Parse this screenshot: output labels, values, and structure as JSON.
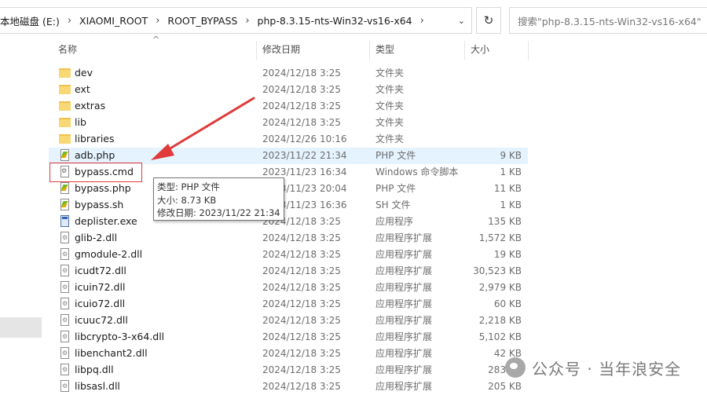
{
  "address": {
    "crumbs": [
      "本地磁盘 (E:)",
      "XIAOMI_ROOT",
      "ROOT_BYPASS",
      "php-8.3.15-nts-Win32-vs16-x64"
    ]
  },
  "search": {
    "placeholder": "搜索\"php-8.3.15-nts-Win32-vs16-x64\""
  },
  "columns": {
    "name": "名称",
    "date": "修改日期",
    "type": "类型",
    "size": "大小"
  },
  "files": [
    {
      "name": "dev",
      "date": "2024/12/18 3:25",
      "type": "文件夹",
      "size": "",
      "icon": "folder-icon"
    },
    {
      "name": "ext",
      "date": "2024/12/18 3:25",
      "type": "文件夹",
      "size": "",
      "icon": "folder-icon"
    },
    {
      "name": "extras",
      "date": "2024/12/18 3:25",
      "type": "文件夹",
      "size": "",
      "icon": "folder-icon"
    },
    {
      "name": "lib",
      "date": "2024/12/18 3:25",
      "type": "文件夹",
      "size": "",
      "icon": "folder-icon"
    },
    {
      "name": "libraries",
      "date": "2024/12/26 10:16",
      "type": "文件夹",
      "size": "",
      "icon": "folder-icon"
    },
    {
      "name": "adb.php",
      "date": "2023/11/22 21:34",
      "type": "PHP 文件",
      "size": "9 KB",
      "icon": "php-file-icon"
    },
    {
      "name": "bypass.cmd",
      "date": "2023/11/23 16:34",
      "type": "Windows 命令脚本",
      "size": "1 KB",
      "icon": "cmd-file-icon"
    },
    {
      "name": "bypass.php",
      "date": "2023/11/23 20:04",
      "type": "PHP 文件",
      "size": "11 KB",
      "icon": "php-file-icon"
    },
    {
      "name": "bypass.sh",
      "date": "2023/11/23 16:36",
      "type": "SH 文件",
      "size": "1 KB",
      "icon": "sh-file-icon"
    },
    {
      "name": "deplister.exe",
      "date": "2024/12/18 3:25",
      "type": "应用程序",
      "size": "135 KB",
      "icon": "exe-file-icon"
    },
    {
      "name": "glib-2.dll",
      "date": "2024/12/18 3:25",
      "type": "应用程序扩展",
      "size": "1,572 KB",
      "icon": "dll-file-icon"
    },
    {
      "name": "gmodule-2.dll",
      "date": "2024/12/18 3:25",
      "type": "应用程序扩展",
      "size": "19 KB",
      "icon": "dll-file-icon"
    },
    {
      "name": "icudt72.dll",
      "date": "2024/12/18 3:25",
      "type": "应用程序扩展",
      "size": "30,523 KB",
      "icon": "dll-file-icon"
    },
    {
      "name": "icuin72.dll",
      "date": "2024/12/18 3:25",
      "type": "应用程序扩展",
      "size": "2,979 KB",
      "icon": "dll-file-icon"
    },
    {
      "name": "icuio72.dll",
      "date": "2024/12/18 3:25",
      "type": "应用程序扩展",
      "size": "60 KB",
      "icon": "dll-file-icon"
    },
    {
      "name": "icuuc72.dll",
      "date": "2024/12/18 3:25",
      "type": "应用程序扩展",
      "size": "2,218 KB",
      "icon": "dll-file-icon"
    },
    {
      "name": "libcrypto-3-x64.dll",
      "date": "2024/12/18 3:25",
      "type": "应用程序扩展",
      "size": "5,102 KB",
      "icon": "dll-file-icon"
    },
    {
      "name": "libenchant2.dll",
      "date": "2024/12/18 3:25",
      "type": "应用程序扩展",
      "size": "42 KB",
      "icon": "dll-file-icon"
    },
    {
      "name": "libpq.dll",
      "date": "2024/12/18 3:25",
      "type": "应用程序扩展",
      "size": "283 KB",
      "icon": "dll-file-icon"
    },
    {
      "name": "libsasl.dll",
      "date": "2024/12/18 3:25",
      "type": "应用程序扩展",
      "size": "205 KB",
      "icon": "dll-file-icon"
    }
  ],
  "tooltip": {
    "type_line": "类型: PHP 文件",
    "size_line": "大小: 8.73 KB",
    "date_line": "修改日期: 2023/11/22 21:34"
  },
  "watermark": {
    "text": "公众号 · 当年浪安全"
  },
  "colors": {
    "annotation": "#e03a3a",
    "hover_row": "#e5f3ff",
    "folder": "#f8d775"
  }
}
